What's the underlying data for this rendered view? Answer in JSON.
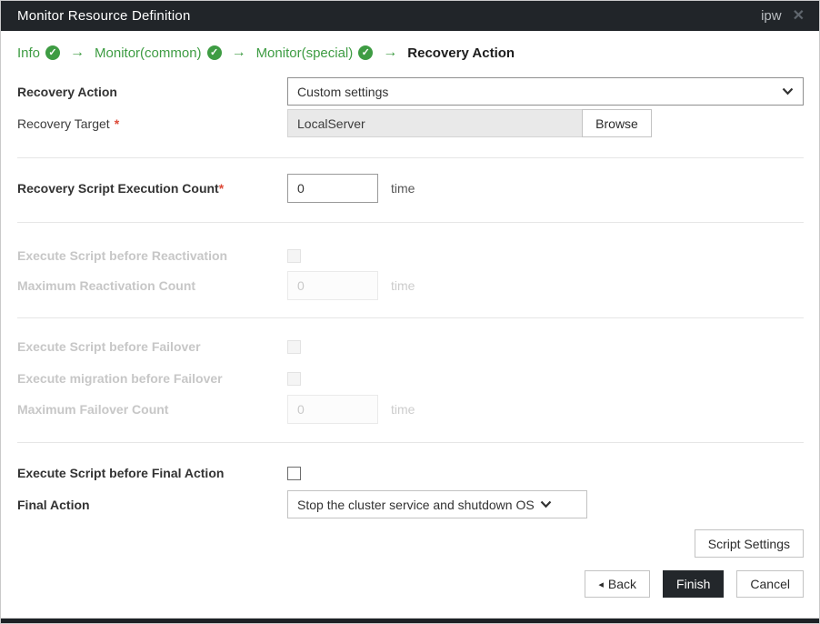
{
  "dialog": {
    "title": "Monitor Resource Definition",
    "window_tag": "ipw"
  },
  "wizard": {
    "steps": [
      {
        "label": "Info",
        "state": "complete"
      },
      {
        "label": "Monitor(common)",
        "state": "complete"
      },
      {
        "label": "Monitor(special)",
        "state": "complete"
      },
      {
        "label": "Recovery Action",
        "state": "current"
      }
    ]
  },
  "form": {
    "recovery_action": {
      "label": "Recovery Action",
      "value": "Custom settings"
    },
    "recovery_target": {
      "label": "Recovery Target",
      "required_mark": "*",
      "value": "LocalServer",
      "browse_label": "Browse"
    },
    "recovery_script_execution_count": {
      "label": "Recovery Script Execution Count",
      "required_mark": "*",
      "value": "0",
      "unit": "time"
    },
    "execute_script_before_reactivation": {
      "label": "Execute Script before Reactivation",
      "checked": false,
      "disabled": true
    },
    "maximum_reactivation_count": {
      "label": "Maximum Reactivation Count",
      "value": "0",
      "unit": "time",
      "disabled": true
    },
    "execute_script_before_failover": {
      "label": "Execute Script before Failover",
      "checked": false,
      "disabled": true
    },
    "execute_migration_before_failover": {
      "label": "Execute migration before Failover",
      "checked": false,
      "disabled": true
    },
    "maximum_failover_count": {
      "label": "Maximum Failover Count",
      "value": "0",
      "unit": "time",
      "disabled": true
    },
    "execute_script_before_final_action": {
      "label": "Execute Script before Final Action",
      "checked": false,
      "disabled": false
    },
    "final_action": {
      "label": "Final Action",
      "value": "Stop the cluster service and shutdown OS"
    }
  },
  "buttons": {
    "script_settings": "Script Settings",
    "back": "Back",
    "finish": "Finish",
    "cancel": "Cancel"
  },
  "icons": {
    "check": "✓",
    "arrow_right": "→",
    "back_triangle": "◂",
    "close": "✕"
  },
  "colors": {
    "accent_green": "#3e9c43",
    "titlebar_bg": "#212529",
    "finish_button_bg": "#23272b",
    "required_red": "#dd4b39",
    "disabled_text": "#c7c7c7"
  }
}
